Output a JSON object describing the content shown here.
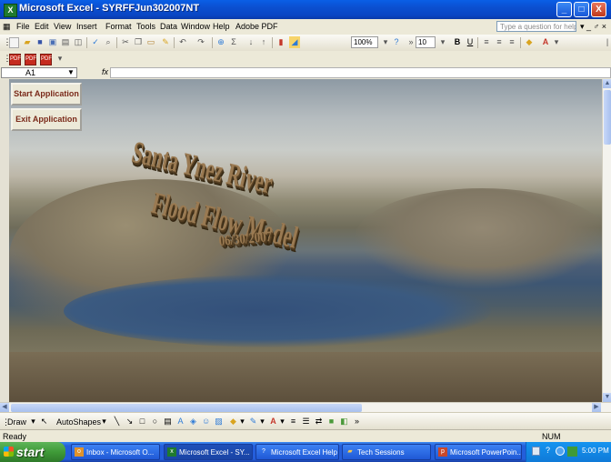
{
  "window": {
    "title": "Microsoft Excel - SYRFFJun302007NT",
    "controls": {
      "minimize": "_",
      "maximize": "□",
      "close": "X"
    }
  },
  "menu": {
    "items": [
      "File",
      "Edit",
      "View",
      "Insert",
      "Format",
      "Tools",
      "Data",
      "Window",
      "Help",
      "Adobe PDF"
    ],
    "help_placeholder": "Type a question for help",
    "window_controls": "▾ _ ♂ ×"
  },
  "toolbar": {
    "zoom": "100%",
    "font_size": "10",
    "bold": "B",
    "underline": "U",
    "font_color": "A"
  },
  "formula_bar": {
    "cell_ref": "A1",
    "fx": "fx",
    "value": ""
  },
  "sheet": {
    "buttons": {
      "start": "Start Application",
      "exit": "Exit Application"
    },
    "wordart": {
      "line1": "Santa Ynez River",
      "line2": "Flood Flow Model",
      "line3": "06/30/2007"
    }
  },
  "drawing_toolbar": {
    "draw": "Draw",
    "autoshapes": "AutoShapes"
  },
  "status": {
    "text": "Ready",
    "num": "NUM"
  },
  "taskbar": {
    "start": "start",
    "tasks": [
      {
        "label": "Inbox - Microsoft O...",
        "icon": "outlook-icon"
      },
      {
        "label": "Microsoft Excel - SY...",
        "icon": "excel-icon",
        "active": true
      },
      {
        "label": "Microsoft Excel Help",
        "icon": "help-icon"
      },
      {
        "label": "Tech Sessions",
        "icon": "folder-icon"
      },
      {
        "label": "Microsoft PowerPoin...",
        "icon": "powerpoint-icon"
      }
    ],
    "clock": "5:00 PM"
  },
  "colors": {
    "titlebar": "#0b4fd0",
    "taskbar": "#245edb",
    "start_green": "#3f9a38",
    "wordart": "#9a7a52"
  }
}
